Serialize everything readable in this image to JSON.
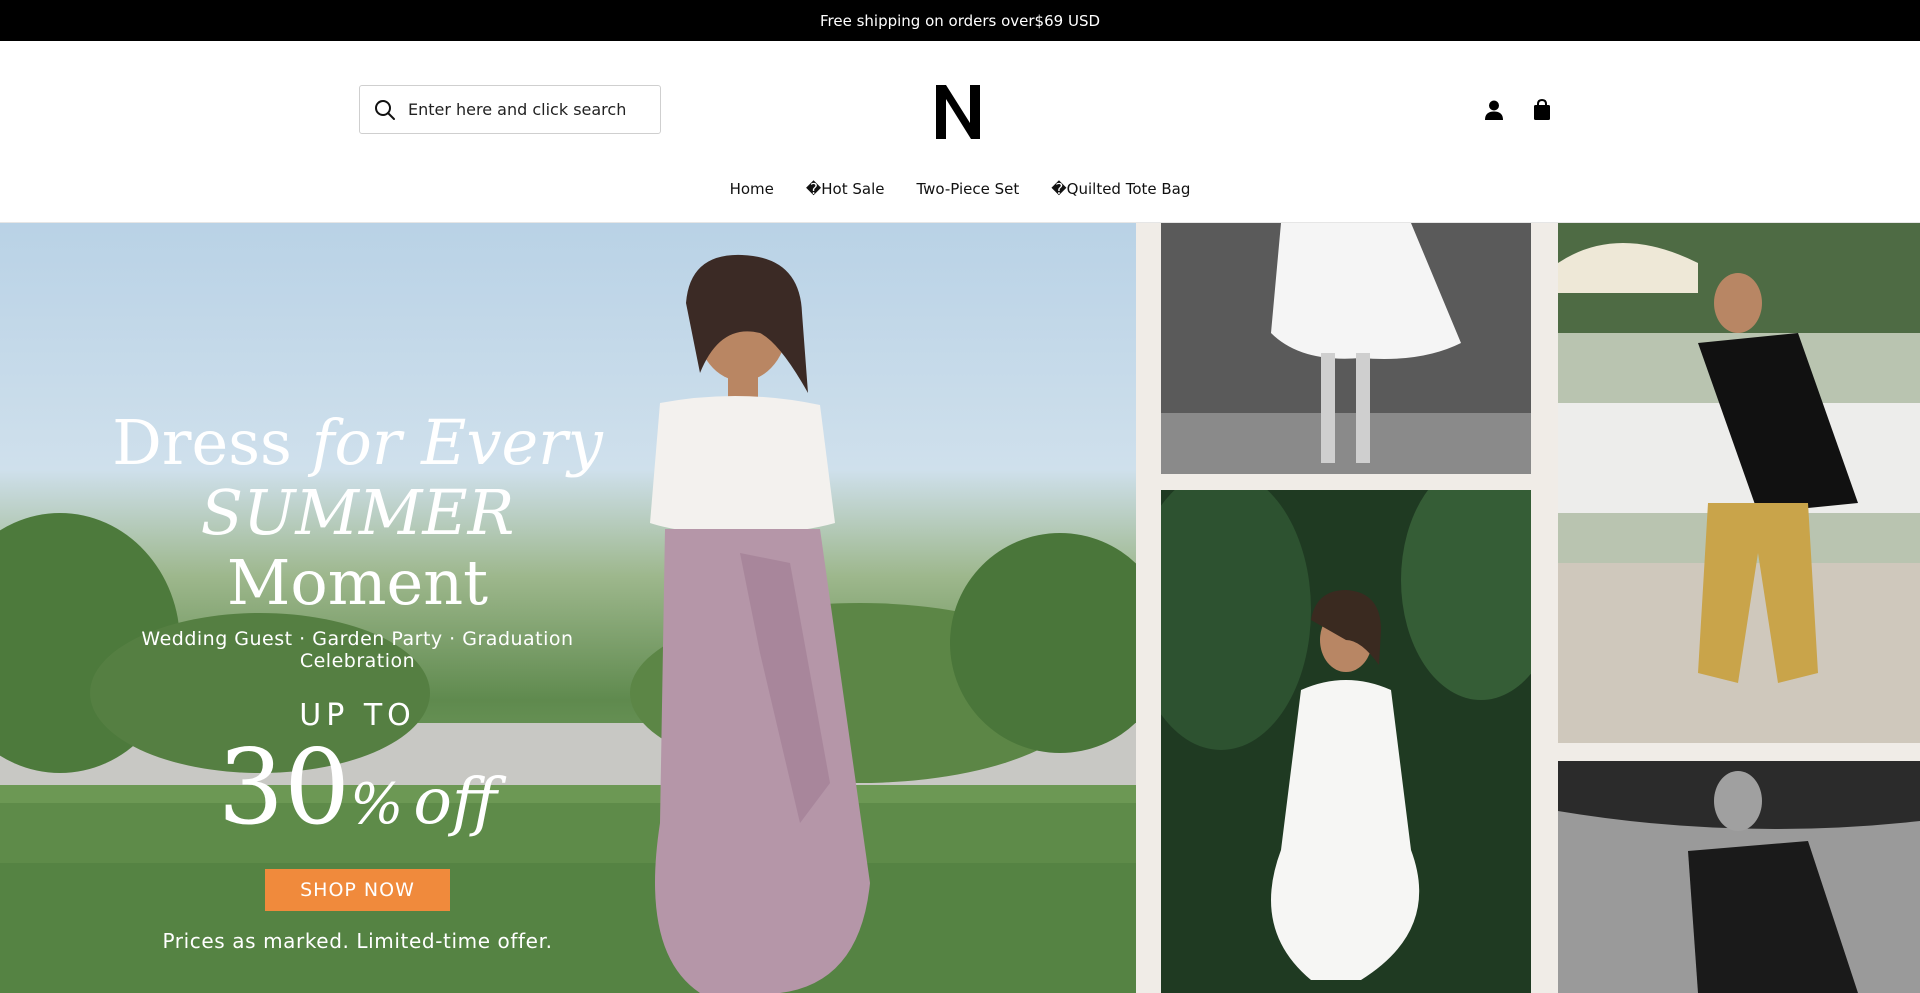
{
  "announcement": {
    "text": "Free shipping on orders over$69 USD"
  },
  "header": {
    "search": {
      "placeholder": "Enter here and click search"
    },
    "logo_text": "N"
  },
  "nav": {
    "items": [
      {
        "label": "Home"
      },
      {
        "label": "�Hot Sale"
      },
      {
        "label": "Two-Piece Set"
      },
      {
        "label": "�Quilted Tote Bag"
      }
    ]
  },
  "hero": {
    "headline_line1_regular": "Dress ",
    "headline_line1_italic": "for Every",
    "headline_line2_italic": "SUMMER",
    "headline_line2_regular": " Moment",
    "tagline": "Wedding Guest · Garden Party · Graduation Celebration",
    "up_to": "UP TO",
    "discount_number": "30",
    "discount_symbol": "%",
    "discount_suffix": "off",
    "cta_label": "SHOP NOW",
    "note": "Prices as marked. Limited-time offer."
  },
  "colors": {
    "announcement_bg": "#000000",
    "cta_bg": "#f08a3c",
    "text": "#111111"
  }
}
